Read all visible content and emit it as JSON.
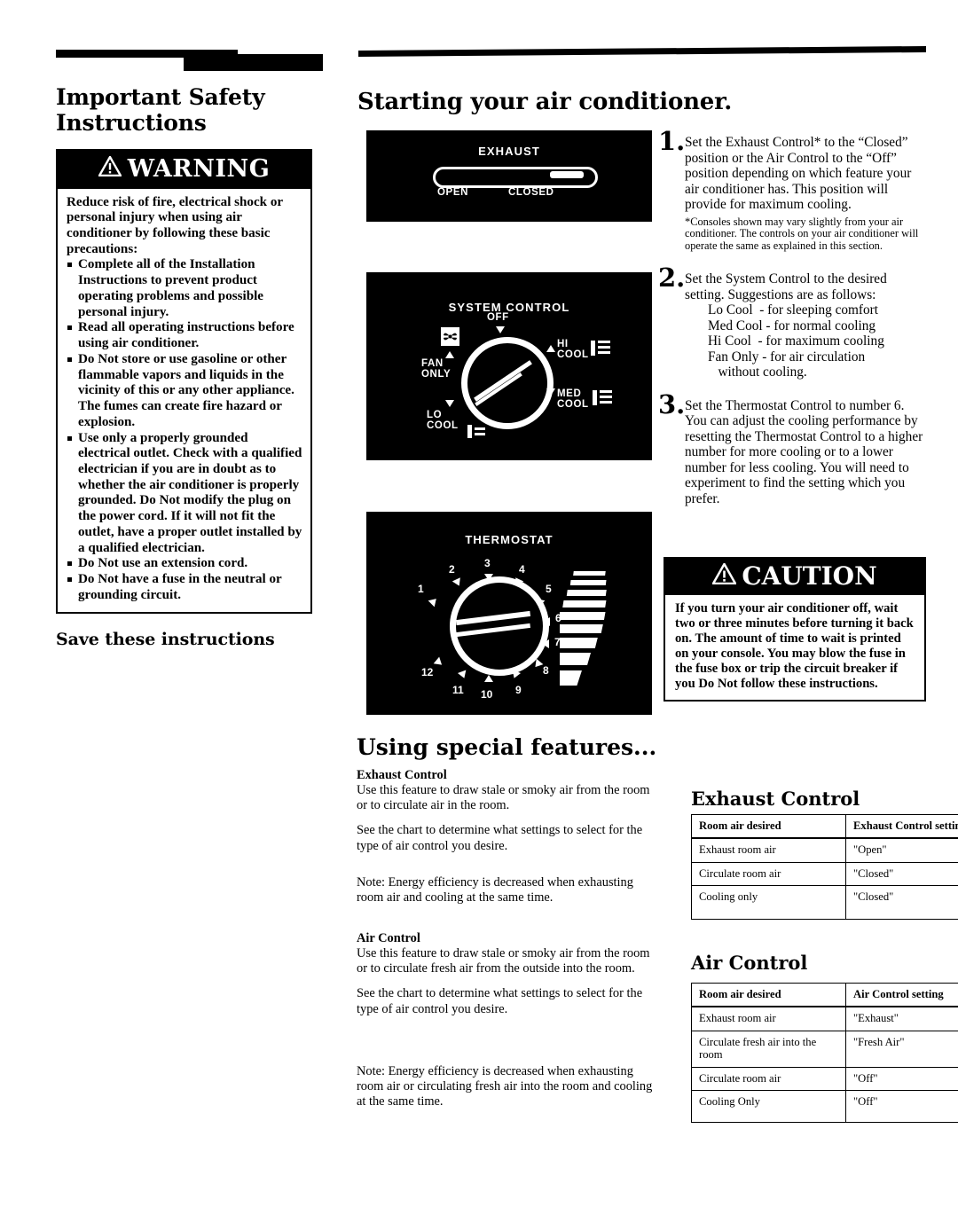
{
  "left_column": {
    "title": "Important Safety Instructions",
    "warning": {
      "banner": "WARNING",
      "intro": "Reduce risk of fire, electrical shock or personal injury when using air conditioner by following these basic precautions:",
      "items": [
        "Complete all of the Installation Instructions to prevent product operating problems and possible personal injury.",
        "Read all operating instructions before using air conditioner.",
        "Do Not store or use gasoline or other flammable vapors and liquids in the vicinity of this or any other appliance.  The fumes can create fire hazard or explosion.",
        "Use only a properly grounded electrical outlet.  Check with a qualified electrician if you are in doubt as to whether the air conditioner is properly grounded.  Do Not modify the plug on the power cord.  If it will not fit the outlet, have a proper outlet installed by a qualified electrician.",
        "Do Not use an extension cord.",
        "Do Not have a fuse in the neutral or grounding circuit."
      ]
    },
    "save_line": "Save these instructions"
  },
  "starting": {
    "title": "Starting your air conditioner.",
    "illustrations": {
      "exhaust": {
        "title": "EXHAUST",
        "label_left": "OPEN",
        "label_right": "CLOSED",
        "knob_position": "CLOSED"
      },
      "system_control": {
        "title": "SYSTEM CONTROL",
        "positions": [
          "OFF",
          "HI COOL",
          "MED COOL",
          "LO COOL",
          "FAN ONLY"
        ],
        "off": "OFF",
        "hi_cool": "HI\nCOOL",
        "med_cool": "MED\nCOOL",
        "lo_cool": "LO\nCOOL",
        "fan_only": "FAN\nONLY"
      },
      "thermostat": {
        "title": "THERMOSTAT",
        "numbers": [
          "1",
          "2",
          "3",
          "4",
          "5",
          "6",
          "7",
          "8",
          "9",
          "10",
          "11",
          "12"
        ]
      }
    },
    "steps": [
      {
        "number": "1.",
        "text": "Set the Exhaust Control* to the “Closed” position or the Air Control to the “Off” position depending on which feature your air conditioner has.  This position will provide for maximum cooling.",
        "footnote": "*Consoles shown may vary slightly from your air conditioner.  The controls on your air conditioner will operate the same as explained in this section."
      },
      {
        "number": "2.",
        "text": "Set the System Control to the desired setting.  Suggestions are as follows:",
        "sublist": [
          "Lo Cool  - for sleeping comfort",
          "Med Cool - for normal cooling",
          "Hi Cool  - for maximum cooling",
          "Fan Only - for air circulation",
          "   without cooling."
        ]
      },
      {
        "number": "3.",
        "text": "Set the Thermostat Control to number 6.  You can adjust the cooling performance by resetting the Thermostat Control to a higher number for more cooling or to a lower number for less cooling.  You will need to experiment to find the setting which you prefer."
      }
    ],
    "caution": {
      "banner": "CAUTION",
      "text": "If you turn your air conditioner off, wait two or three minutes before turning it back on.  The amount of time to wait is printed on your console. You may blow the fuse in the fuse box or trip the circuit breaker if you Do Not follow these instructions."
    }
  },
  "special_features": {
    "title": "Using special features...",
    "exhaust_control": {
      "heading": "Exhaust Control",
      "p1": "Use this feature to draw stale or smoky air from the room or to circulate air in the room.",
      "p2": "See the chart to determine what settings to select for the type of air control you desire.",
      "note": "Note: Energy efficiency is decreased when exhausting room air and cooling at the same time."
    },
    "air_control": {
      "heading": "Air Control",
      "p1": "Use this feature to draw stale or smoky air from the room or to circulate fresh air from the outside into the room.",
      "p2": "See the chart to determine what settings to select for the type of air control you desire.",
      "note": "Note: Energy efficiency is decreased when exhausting room air or circulating fresh air into the room and cooling at the same time."
    },
    "exhaust_table": {
      "title": "Exhaust Control",
      "columns": [
        "Room air  desired",
        "Exhaust Control setting"
      ],
      "rows": [
        [
          "Exhaust room air",
          "\"Open\""
        ],
        [
          "Circulate room air",
          "\"Closed\""
        ],
        [
          "Cooling only",
          "\"Closed\""
        ]
      ]
    },
    "air_table": {
      "title": "Air Control",
      "columns": [
        "Room air desired",
        "Air Control setting"
      ],
      "rows": [
        [
          "Exhaust room air",
          "\"Exhaust\""
        ],
        [
          "Circulate fresh air into the room",
          "\"Fresh Air\""
        ],
        [
          "Circulate room air",
          "\"Off\""
        ],
        [
          "Cooling Only",
          "\"Off\""
        ]
      ]
    }
  }
}
